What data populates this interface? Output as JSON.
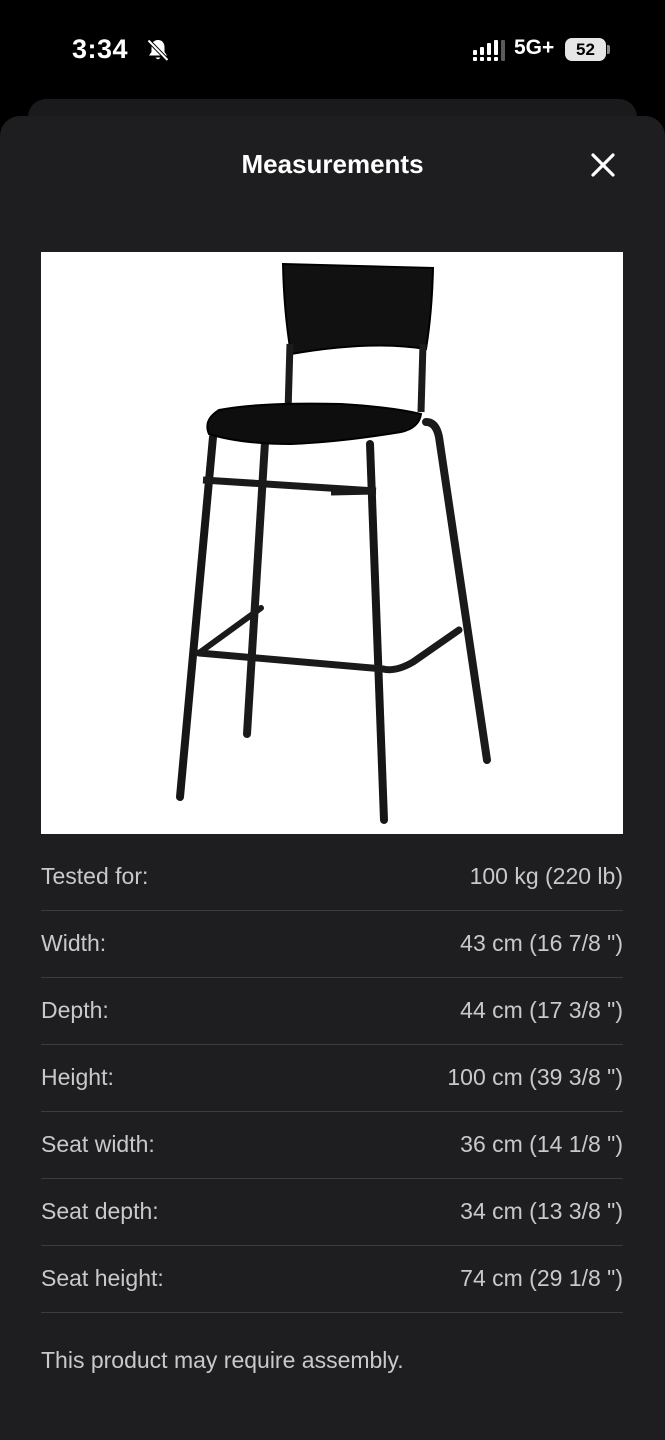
{
  "status_bar": {
    "time": "3:34",
    "network": "5G+",
    "battery": "52",
    "icons": [
      "bell-slash-icon",
      "signal-icon",
      "battery-icon"
    ]
  },
  "sheet": {
    "title": "Measurements",
    "close_icon": "close-icon"
  },
  "product_image": {
    "subject": "bar stool with backrest",
    "icon": "product-photo"
  },
  "measurements": [
    {
      "label": "Tested for:",
      "value": "100 kg (220 lb)"
    },
    {
      "label": "Width:",
      "value": "43 cm (16 7/8 \")"
    },
    {
      "label": "Depth:",
      "value": "44 cm (17 3/8 \")"
    },
    {
      "label": "Height:",
      "value": "100 cm (39 3/8 \")"
    },
    {
      "label": "Seat width:",
      "value": "36 cm (14 1/8 \")"
    },
    {
      "label": "Seat depth:",
      "value": "34 cm (13 3/8 \")"
    },
    {
      "label": "Seat height:",
      "value": "74 cm (29 1/8 \")"
    }
  ],
  "note": "This product may require assembly.",
  "colors": {
    "sheet_background": "#1e1e20",
    "text": "#c9c9cb",
    "title": "#ffffff",
    "divider": "#3c3c3f"
  }
}
